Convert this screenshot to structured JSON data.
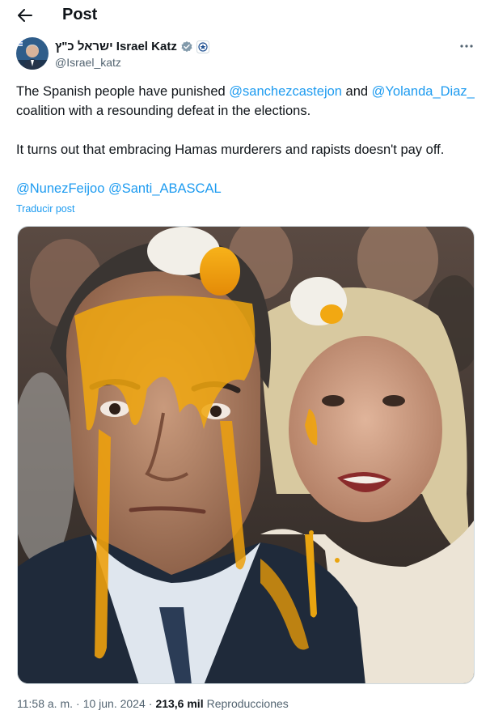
{
  "header": {
    "title": "Post",
    "back_icon": "arrow-left-icon"
  },
  "author": {
    "display_name": "ישראל כ\"ץ Israel Katz",
    "handle": "@Israel_katz",
    "verified_icon": "gray-verified-badge-icon",
    "affiliate_icon": "government-seal-icon",
    "more_icon": "more-horizontal-icon"
  },
  "tweet": {
    "p1_a": "The Spanish people have punished ",
    "p1_mention1": "@sanchezcastejon",
    "p1_b": " and ",
    "p1_mention2": "@Yolanda_Diaz_",
    "p1_c": " coalition with a resounding defeat in the elections.",
    "p2": "It turns out that embracing Hamas murderers and rapists doesn't pay off.",
    "p3_mention1": "@NunezFeijoo",
    "p3_mention2": "@Santi_ABASCAL",
    "translate_label": "Traducir post"
  },
  "meta": {
    "time": "11:58 a. m.",
    "separator": "·",
    "date": "10 jun. 2024",
    "views_count": "213,6 mil",
    "views_label": "Reproducciones"
  },
  "colors": {
    "link": "#1d9bf0",
    "text": "#0f1419",
    "muted": "#536471",
    "verified_gray": "#829aab"
  }
}
